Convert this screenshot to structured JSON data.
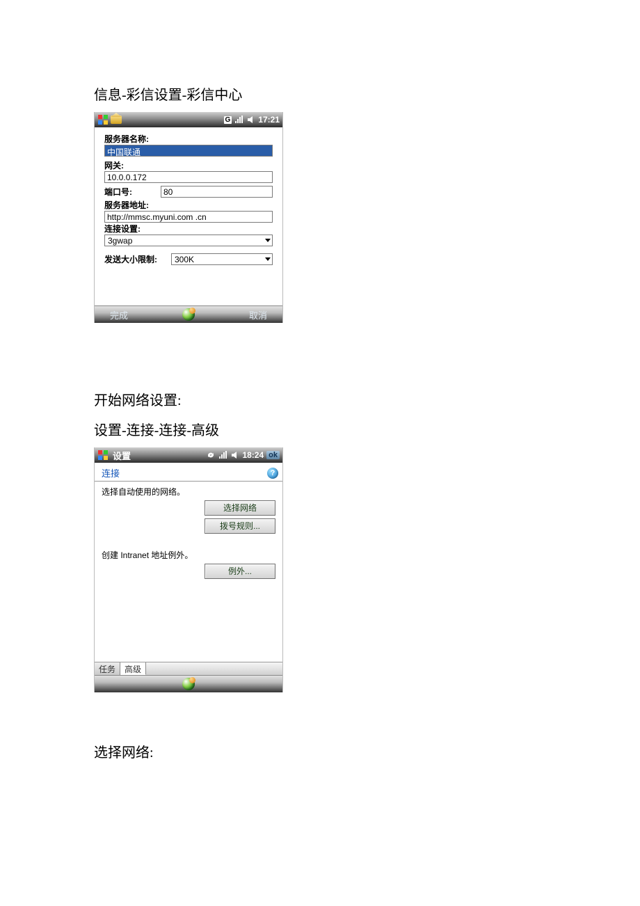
{
  "headings": {
    "mms_center": "信息-彩信设置-彩信中心",
    "start_net": "开始网络设置:",
    "conn_adv": "设置-连接-连接-高级",
    "select_net": "选择网络:"
  },
  "screen1": {
    "status": {
      "g_label": "G",
      "time": "17:21"
    },
    "labels": {
      "server_name": "服务器名称:",
      "gateway": "网关:",
      "port": "端口号:",
      "server_addr": "服务器地址:",
      "conn_setting": "连接设置:",
      "send_limit": "发送大小限制:"
    },
    "values": {
      "server_name": "中国联通",
      "gateway": "10.0.0.172",
      "port": "80",
      "server_addr": "http://mmsc.myuni.com .cn",
      "conn_setting": "3gwap",
      "send_limit": "300K"
    },
    "softkeys": {
      "left": "完成",
      "right": "取消"
    }
  },
  "screen2": {
    "status": {
      "title": "设置",
      "time": "18:24",
      "ok": "ok"
    },
    "tab_link": "连接",
    "body": {
      "choose_net_text": "选择自动使用的网络。",
      "btn_select_net": "选择网络",
      "btn_dial_rules": "拨号规则...",
      "intranet_text": "创建 Intranet 地址例外。",
      "btn_exception": "例外..."
    },
    "tabs": {
      "tasks": "任务",
      "advanced": "高级"
    }
  }
}
